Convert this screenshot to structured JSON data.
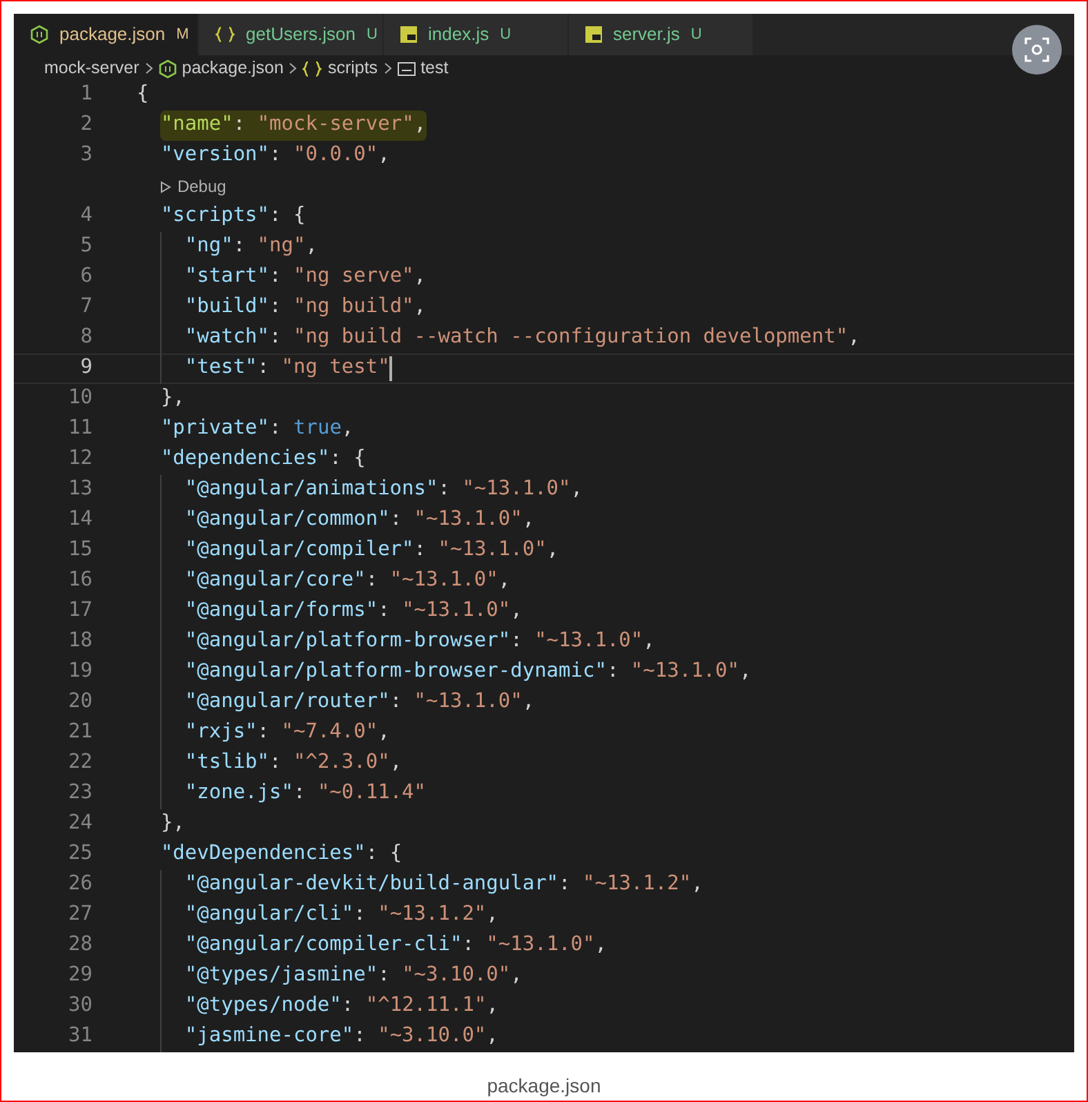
{
  "tabs": [
    {
      "label": "package.json",
      "status": "M",
      "color": "#e2c08d",
      "kind": "node",
      "selected": true
    },
    {
      "label": "getUsers.json",
      "status": "U",
      "color": "#73c991",
      "kind": "braces",
      "selected": false
    },
    {
      "label": "index.js",
      "status": "U",
      "color": "#73c991",
      "kind": "js",
      "selected": false
    },
    {
      "label": "server.js",
      "status": "U",
      "color": "#73c991",
      "kind": "js",
      "selected": false
    }
  ],
  "breadcrumb": [
    {
      "label": "mock-server",
      "kind": "folder"
    },
    {
      "label": "package.json",
      "kind": "node"
    },
    {
      "label": "scripts",
      "kind": "braces"
    },
    {
      "label": "test",
      "kind": "string"
    }
  ],
  "lines": [
    {
      "kind": "code",
      "number": "1",
      "tokens": [
        {
          "kind": "punct",
          "text": "{"
        }
      ],
      "children": [
        {
          "kind": "code",
          "number": "2",
          "highlighted": true,
          "tokens": [
            {
              "kind": "key",
              "text": "\"name\""
            },
            {
              "kind": "punct",
              "text": ": "
            },
            {
              "kind": "string",
              "text": "\"mock-server\""
            },
            {
              "kind": "punct",
              "text": ","
            }
          ]
        },
        {
          "kind": "code",
          "number": "3",
          "tokens": [
            {
              "kind": "key",
              "text": "\"version\""
            },
            {
              "kind": "punct",
              "text": ": "
            },
            {
              "kind": "string",
              "text": "\"0.0.0\""
            },
            {
              "kind": "punct",
              "text": ","
            }
          ]
        },
        {
          "kind": "codelens",
          "text": "Debug"
        },
        {
          "kind": "code",
          "number": "4",
          "tokens": [
            {
              "kind": "key",
              "text": "\"scripts\""
            },
            {
              "kind": "punct",
              "text": ": {"
            }
          ],
          "children": [
            {
              "kind": "code",
              "number": "5",
              "tokens": [
                {
                  "kind": "key",
                  "text": "\"ng\""
                },
                {
                  "kind": "punct",
                  "text": ": "
                },
                {
                  "kind": "string",
                  "text": "\"ng\""
                },
                {
                  "kind": "punct",
                  "text": ","
                }
              ]
            },
            {
              "kind": "code",
              "number": "6",
              "tokens": [
                {
                  "kind": "key",
                  "text": "\"start\""
                },
                {
                  "kind": "punct",
                  "text": ": "
                },
                {
                  "kind": "string",
                  "text": "\"ng serve\""
                },
                {
                  "kind": "punct",
                  "text": ","
                }
              ]
            },
            {
              "kind": "code",
              "number": "7",
              "tokens": [
                {
                  "kind": "key",
                  "text": "\"build\""
                },
                {
                  "kind": "punct",
                  "text": ": "
                },
                {
                  "kind": "string",
                  "text": "\"ng build\""
                },
                {
                  "kind": "punct",
                  "text": ","
                }
              ]
            },
            {
              "kind": "code",
              "number": "8",
              "tokens": [
                {
                  "kind": "key",
                  "text": "\"watch\""
                },
                {
                  "kind": "punct",
                  "text": ": "
                },
                {
                  "kind": "string",
                  "text": "\"ng build --watch --configuration development\""
                },
                {
                  "kind": "punct",
                  "text": ","
                }
              ]
            },
            {
              "kind": "code",
              "number": "9",
              "current": true,
              "tokens": [
                {
                  "kind": "key",
                  "text": "\"test\""
                },
                {
                  "kind": "punct",
                  "text": ": "
                },
                {
                  "kind": "string",
                  "text": "\"ng test\""
                }
              ]
            }
          ]
        },
        {
          "kind": "code",
          "number": "10",
          "tokens": [
            {
              "kind": "punct",
              "text": "},"
            }
          ]
        },
        {
          "kind": "code",
          "number": "11",
          "tokens": [
            {
              "kind": "key",
              "text": "\"private\""
            },
            {
              "kind": "punct",
              "text": ": "
            },
            {
              "kind": "keyword",
              "text": "true"
            },
            {
              "kind": "punct",
              "text": ","
            }
          ]
        },
        {
          "kind": "code",
          "number": "12",
          "tokens": [
            {
              "kind": "key",
              "text": "\"dependencies\""
            },
            {
              "kind": "punct",
              "text": ": {"
            }
          ],
          "children": [
            {
              "kind": "code",
              "number": "13",
              "tokens": [
                {
                  "kind": "key",
                  "text": "\"@angular/animations\""
                },
                {
                  "kind": "punct",
                  "text": ": "
                },
                {
                  "kind": "string",
                  "text": "\"~13.1.0\""
                },
                {
                  "kind": "punct",
                  "text": ","
                }
              ]
            },
            {
              "kind": "code",
              "number": "14",
              "tokens": [
                {
                  "kind": "key",
                  "text": "\"@angular/common\""
                },
                {
                  "kind": "punct",
                  "text": ": "
                },
                {
                  "kind": "string",
                  "text": "\"~13.1.0\""
                },
                {
                  "kind": "punct",
                  "text": ","
                }
              ]
            },
            {
              "kind": "code",
              "number": "15",
              "tokens": [
                {
                  "kind": "key",
                  "text": "\"@angular/compiler\""
                },
                {
                  "kind": "punct",
                  "text": ": "
                },
                {
                  "kind": "string",
                  "text": "\"~13.1.0\""
                },
                {
                  "kind": "punct",
                  "text": ","
                }
              ]
            },
            {
              "kind": "code",
              "number": "16",
              "tokens": [
                {
                  "kind": "key",
                  "text": "\"@angular/core\""
                },
                {
                  "kind": "punct",
                  "text": ": "
                },
                {
                  "kind": "string",
                  "text": "\"~13.1.0\""
                },
                {
                  "kind": "punct",
                  "text": ","
                }
              ]
            },
            {
              "kind": "code",
              "number": "17",
              "tokens": [
                {
                  "kind": "key",
                  "text": "\"@angular/forms\""
                },
                {
                  "kind": "punct",
                  "text": ": "
                },
                {
                  "kind": "string",
                  "text": "\"~13.1.0\""
                },
                {
                  "kind": "punct",
                  "text": ","
                }
              ]
            },
            {
              "kind": "code",
              "number": "18",
              "tokens": [
                {
                  "kind": "key",
                  "text": "\"@angular/platform-browser\""
                },
                {
                  "kind": "punct",
                  "text": ": "
                },
                {
                  "kind": "string",
                  "text": "\"~13.1.0\""
                },
                {
                  "kind": "punct",
                  "text": ","
                }
              ]
            },
            {
              "kind": "code",
              "number": "19",
              "tokens": [
                {
                  "kind": "key",
                  "text": "\"@angular/platform-browser-dynamic\""
                },
                {
                  "kind": "punct",
                  "text": ": "
                },
                {
                  "kind": "string",
                  "text": "\"~13.1.0\""
                },
                {
                  "kind": "punct",
                  "text": ","
                }
              ]
            },
            {
              "kind": "code",
              "number": "20",
              "tokens": [
                {
                  "kind": "key",
                  "text": "\"@angular/router\""
                },
                {
                  "kind": "punct",
                  "text": ": "
                },
                {
                  "kind": "string",
                  "text": "\"~13.1.0\""
                },
                {
                  "kind": "punct",
                  "text": ","
                }
              ]
            },
            {
              "kind": "code",
              "number": "21",
              "tokens": [
                {
                  "kind": "key",
                  "text": "\"rxjs\""
                },
                {
                  "kind": "punct",
                  "text": ": "
                },
                {
                  "kind": "string",
                  "text": "\"~7.4.0\""
                },
                {
                  "kind": "punct",
                  "text": ","
                }
              ]
            },
            {
              "kind": "code",
              "number": "22",
              "tokens": [
                {
                  "kind": "key",
                  "text": "\"tslib\""
                },
                {
                  "kind": "punct",
                  "text": ": "
                },
                {
                  "kind": "string",
                  "text": "\"^2.3.0\""
                },
                {
                  "kind": "punct",
                  "text": ","
                }
              ]
            },
            {
              "kind": "code",
              "number": "23",
              "tokens": [
                {
                  "kind": "key",
                  "text": "\"zone.js\""
                },
                {
                  "kind": "punct",
                  "text": ": "
                },
                {
                  "kind": "string",
                  "text": "\"~0.11.4\""
                }
              ]
            }
          ]
        },
        {
          "kind": "code",
          "number": "24",
          "tokens": [
            {
              "kind": "punct",
              "text": "},"
            }
          ]
        },
        {
          "kind": "code",
          "number": "25",
          "tokens": [
            {
              "kind": "key",
              "text": "\"devDependencies\""
            },
            {
              "kind": "punct",
              "text": ": {"
            }
          ],
          "children": [
            {
              "kind": "code",
              "number": "26",
              "tokens": [
                {
                  "kind": "key",
                  "text": "\"@angular-devkit/build-angular\""
                },
                {
                  "kind": "punct",
                  "text": ": "
                },
                {
                  "kind": "string",
                  "text": "\"~13.1.2\""
                },
                {
                  "kind": "punct",
                  "text": ","
                }
              ]
            },
            {
              "kind": "code",
              "number": "27",
              "tokens": [
                {
                  "kind": "key",
                  "text": "\"@angular/cli\""
                },
                {
                  "kind": "punct",
                  "text": ": "
                },
                {
                  "kind": "string",
                  "text": "\"~13.1.2\""
                },
                {
                  "kind": "punct",
                  "text": ","
                }
              ]
            },
            {
              "kind": "code",
              "number": "28",
              "tokens": [
                {
                  "kind": "key",
                  "text": "\"@angular/compiler-cli\""
                },
                {
                  "kind": "punct",
                  "text": ": "
                },
                {
                  "kind": "string",
                  "text": "\"~13.1.0\""
                },
                {
                  "kind": "punct",
                  "text": ","
                }
              ]
            },
            {
              "kind": "code",
              "number": "29",
              "tokens": [
                {
                  "kind": "key",
                  "text": "\"@types/jasmine\""
                },
                {
                  "kind": "punct",
                  "text": ": "
                },
                {
                  "kind": "string",
                  "text": "\"~3.10.0\""
                },
                {
                  "kind": "punct",
                  "text": ","
                }
              ]
            },
            {
              "kind": "code",
              "number": "30",
              "tokens": [
                {
                  "kind": "key",
                  "text": "\"@types/node\""
                },
                {
                  "kind": "punct",
                  "text": ": "
                },
                {
                  "kind": "string",
                  "text": "\"^12.11.1\""
                },
                {
                  "kind": "punct",
                  "text": ","
                }
              ]
            },
            {
              "kind": "code",
              "number": "31",
              "tokens": [
                {
                  "kind": "key",
                  "text": "\"jasmine-core\""
                },
                {
                  "kind": "punct",
                  "text": ": "
                },
                {
                  "kind": "string",
                  "text": "\"~3.10.0\""
                },
                {
                  "kind": "punct",
                  "text": ","
                }
              ]
            }
          ]
        }
      ]
    }
  ],
  "caption": "package.json"
}
